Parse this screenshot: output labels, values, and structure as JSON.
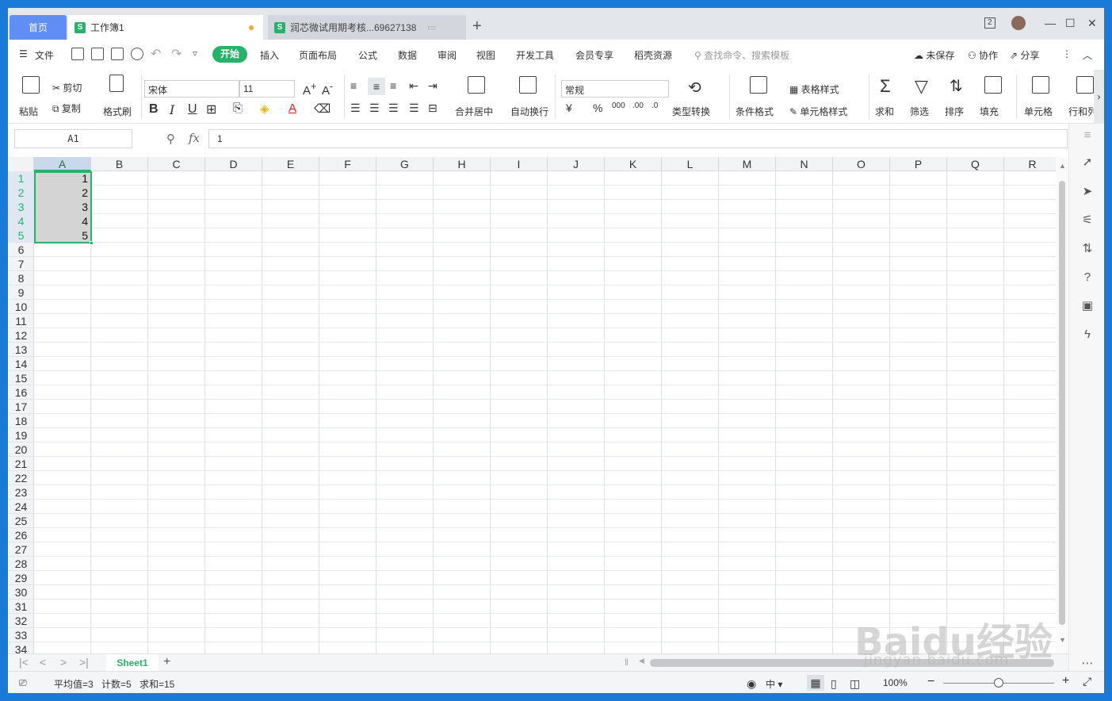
{
  "titlebar": {
    "home_tab": "首页",
    "tab1": "工作簿1",
    "tab2": "润芯微试用期考核...69627138",
    "new_tab": "+",
    "window_controls": [
      "2",
      "—",
      "☐",
      "✕"
    ]
  },
  "menu": {
    "file": "文件",
    "items": [
      "开始",
      "插入",
      "页面布局",
      "公式",
      "数据",
      "审阅",
      "视图",
      "开发工具",
      "会员专享",
      "稻壳资源"
    ],
    "search_placeholder": "查找命令、搜索模板",
    "unsaved": "未保存",
    "collab": "协作",
    "share": "分享"
  },
  "ribbon": {
    "paste": "粘贴",
    "cut": "剪切",
    "copy": "复制",
    "format_painter": "格式刷",
    "font_name": "宋体",
    "font_size": "11",
    "merge_center": "合并居中",
    "wrap_text": "自动换行",
    "number_format": "常规",
    "type_convert": "类型转换",
    "conditional_format": "条件格式",
    "table_style": "表格样式",
    "cell_style": "单元格样式",
    "sum": "求和",
    "filter": "筛选",
    "sort": "排序",
    "fill": "填充",
    "cell": "单元格",
    "row_col": "行和列"
  },
  "formula_bar": {
    "name_box": "A1",
    "fx": "fx",
    "value": "1"
  },
  "grid": {
    "columns": [
      "A",
      "B",
      "C",
      "D",
      "E",
      "F",
      "G",
      "H",
      "I",
      "J",
      "K",
      "L",
      "M",
      "N",
      "O",
      "P",
      "Q",
      "R"
    ],
    "rows": [
      "1",
      "2",
      "3",
      "4",
      "5",
      "6",
      "7",
      "8",
      "9",
      "10",
      "11",
      "12",
      "13",
      "14",
      "15",
      "16",
      "17",
      "18",
      "19",
      "20",
      "21",
      "22",
      "23",
      "24",
      "25",
      "26",
      "27",
      "28",
      "29",
      "30",
      "31",
      "32",
      "33",
      "34"
    ],
    "column_a_values": [
      "1",
      "2",
      "3",
      "4",
      "5"
    ]
  },
  "sheets": {
    "active": "Sheet1",
    "add": "+"
  },
  "statusbar": {
    "average": "平均值=3",
    "count": "计数=5",
    "sum": "求和=15",
    "zoom": "100%"
  },
  "watermark": {
    "main": "Baidu经验",
    "sub": "jingyan.baidu.com"
  },
  "colors": {
    "accent": "#27b26a",
    "home_tab": "#5f8ff5",
    "desktop": "#1a7ad8"
  }
}
